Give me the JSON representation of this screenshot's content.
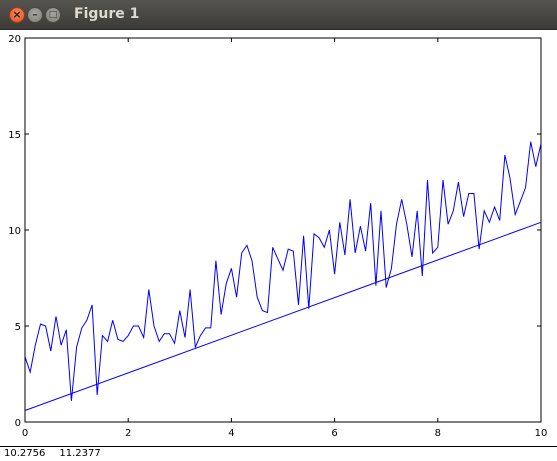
{
  "window": {
    "title": "Figure 1",
    "buttons": {
      "close": "×",
      "minimize": "–",
      "maximize": "□"
    }
  },
  "status": {
    "x": "10.2756",
    "y": "11.2377"
  },
  "chart_data": {
    "type": "line",
    "title": "",
    "xlabel": "",
    "ylabel": "",
    "xlim": [
      0,
      10
    ],
    "ylim": [
      0,
      20
    ],
    "xticks": [
      0,
      2,
      4,
      6,
      8,
      10
    ],
    "yticks": [
      0,
      5,
      10,
      15,
      20
    ],
    "grid": false,
    "line_color": "#0000ff",
    "series": [
      {
        "x": [
          0,
          0.1,
          0.2,
          0.3,
          0.4,
          0.5,
          0.6,
          0.7,
          0.8,
          0.9,
          1.0,
          1.1,
          1.2,
          1.3,
          1.4,
          1.5,
          1.6,
          1.7,
          1.8,
          1.9,
          2.0,
          2.1,
          2.2,
          2.3,
          2.4,
          2.5,
          2.6,
          2.7,
          2.8,
          2.9,
          3.0,
          3.1,
          3.2,
          3.3,
          3.4,
          3.5,
          3.6,
          3.7,
          3.8,
          3.9,
          4.0,
          4.1,
          4.2,
          4.3,
          4.4,
          4.5,
          4.6,
          4.7,
          4.8,
          4.9,
          5.0,
          5.1,
          5.2,
          5.3,
          5.4,
          5.5,
          5.6,
          5.7,
          5.8,
          5.9,
          6.0,
          6.1,
          6.2,
          6.3,
          6.4,
          6.5,
          6.6,
          6.7,
          6.8,
          6.9,
          7.0,
          7.1,
          7.2,
          7.3,
          7.4,
          7.5,
          7.6,
          7.7,
          7.8,
          7.9,
          8.0,
          8.1,
          8.2,
          8.3,
          8.4,
          8.5,
          8.6,
          8.7,
          8.8,
          8.9,
          9.0,
          9.1,
          9.2,
          9.3,
          9.4,
          9.5,
          9.6,
          9.7,
          9.8,
          9.9,
          10.0
        ],
        "y": [
          3.4,
          2.6,
          4.0,
          5.1,
          5.0,
          3.7,
          5.5,
          4.0,
          4.8,
          1.1,
          3.9,
          4.9,
          5.3,
          6.1,
          1.4,
          4.5,
          4.2,
          5.3,
          4.3,
          4.2,
          4.5,
          5.0,
          5.0,
          4.4,
          6.9,
          5.0,
          4.2,
          4.6,
          4.6,
          4.1,
          5.8,
          4.4,
          6.9,
          3.9,
          4.5,
          4.9,
          4.9,
          8.4,
          5.6,
          7.2,
          8.0,
          6.5,
          8.8,
          9.2,
          8.4,
          6.5,
          5.8,
          5.7,
          9.1,
          8.5,
          7.9,
          9.0,
          8.9,
          6.1,
          9.7,
          5.9,
          9.8,
          9.6,
          9.1,
          10.0,
          7.7,
          10.4,
          8.7,
          11.6,
          8.8,
          10.2,
          8.9,
          11.4,
          7.1,
          11.0,
          7.0,
          8.0,
          10.3,
          11.6,
          10.3,
          8.6,
          11.0,
          7.6,
          12.6,
          8.8,
          9.1,
          12.6,
          10.3,
          11.0,
          12.5,
          10.7,
          11.9,
          11.9,
          9.0,
          11.0,
          10.4,
          11.2,
          10.5,
          13.9,
          12.7,
          10.8,
          11.5,
          12.2,
          14.6,
          13.3,
          14.5
        ]
      },
      {
        "x": [
          0,
          10
        ],
        "y": [
          0.6,
          10.4
        ]
      }
    ]
  }
}
